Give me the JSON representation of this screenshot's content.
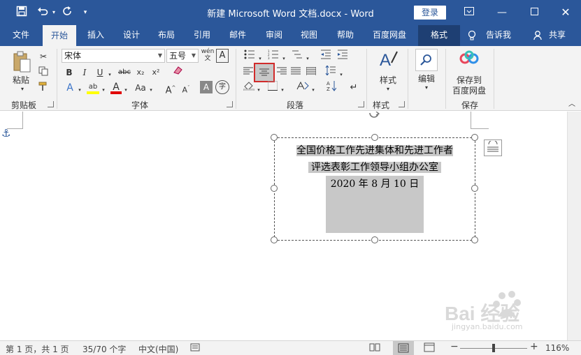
{
  "titlebar": {
    "title": "新建 Microsoft Word 文档.docx  -  Word",
    "login": "登录",
    "bg_color": "#2b579a"
  },
  "tabs": [
    {
      "label": "文件"
    },
    {
      "label": "开始"
    },
    {
      "label": "插入"
    },
    {
      "label": "设计"
    },
    {
      "label": "布局"
    },
    {
      "label": "引用"
    },
    {
      "label": "邮件"
    },
    {
      "label": "审阅"
    },
    {
      "label": "视图"
    },
    {
      "label": "帮助"
    },
    {
      "label": "百度网盘"
    },
    {
      "label": "格式"
    },
    {
      "label": "告诉我"
    },
    {
      "label": "共享"
    }
  ],
  "ribbon": {
    "paste_label": "粘贴",
    "font_name": "宋体",
    "font_size": "五号",
    "styles_label": "样式",
    "edit_label": "编辑",
    "save_to_label": "保存到",
    "baidu_label": "百度网盘",
    "groups": {
      "clipboard": "剪贴板",
      "font": "字体",
      "paragraph": "段落",
      "styles": "样式",
      "save": "保存"
    }
  },
  "textbox": {
    "line1": "全国价格工作先进集体和先进工作者",
    "line2": "评选表彰工作领导小组办公室",
    "line3": "2020 年 8 月 10 日"
  },
  "statusbar": {
    "page": "第 1 页，共 1 页",
    "words": "35/70 个字",
    "language": "中文(中国)",
    "zoom": "116%"
  },
  "watermark": {
    "text": "Bai 经验",
    "url": "jingyan.baidu.com"
  }
}
